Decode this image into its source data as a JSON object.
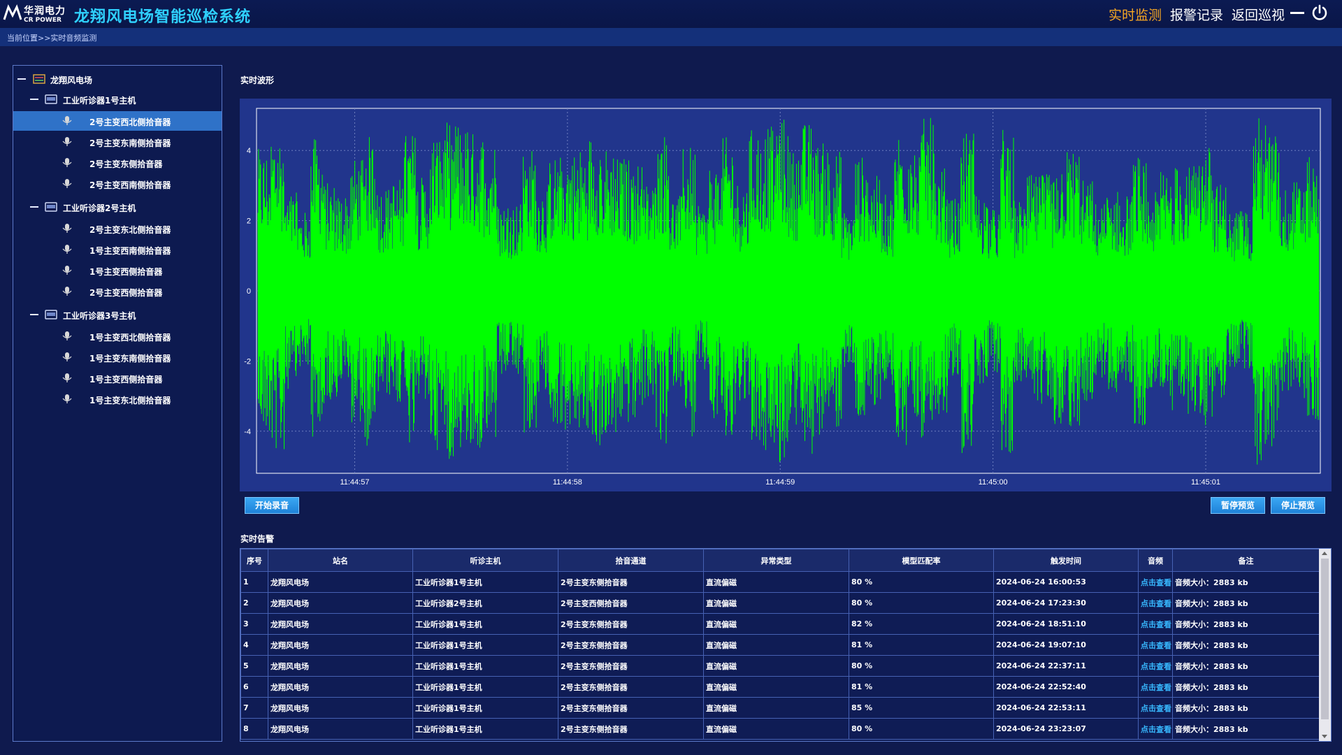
{
  "header": {
    "logo_main": "华润电力",
    "logo_sub": "CR POWER",
    "title": "龙翔风电场智能巡检系统",
    "nav": [
      {
        "label": "实时监测",
        "active": true
      },
      {
        "label": "报警记录",
        "active": false
      },
      {
        "label": "返回巡视",
        "active": false
      }
    ]
  },
  "breadcrumb": "当前位置>>实时音频监测",
  "tree": {
    "root": "龙翔风电场",
    "hosts": [
      {
        "name": "工业听诊器1号主机",
        "channels": [
          "2号主变西北侧拾音器",
          "2号主变东南侧拾音器",
          "2号主变东侧拾音器",
          "2号主变西南侧拾音器"
        ]
      },
      {
        "name": "工业听诊器2号主机",
        "channels": [
          "2号主变东北侧拾音器",
          "1号主变西南侧拾音器",
          "1号主变西侧拾音器",
          "2号主变西侧拾音器"
        ]
      },
      {
        "name": "工业听诊器3号主机",
        "channels": [
          "1号主变西北侧拾音器",
          "1号主变东南侧拾音器",
          "1号主变西侧拾音器",
          "1号主变东北侧拾音器"
        ]
      }
    ],
    "selected": "2号主变西北侧拾音器"
  },
  "waveform": {
    "section_title": "实时波形",
    "y_ticks": [
      "4",
      "2",
      "0",
      "-2",
      "-4"
    ],
    "x_ticks": [
      "11:44:57",
      "11:44:58",
      "11:44:59",
      "11:45:00",
      "11:45:01"
    ],
    "line_color": "#00ff00",
    "background_color": "#21358c",
    "buttons": {
      "record": "开始录音",
      "pause": "暂停预览",
      "stop": "停止预览"
    }
  },
  "alarms": {
    "section_title": "实时告警",
    "columns": [
      "序号",
      "站名",
      "听诊主机",
      "拾音通道",
      "异常类型",
      "模型匹配率",
      "触发时间",
      "音频",
      "备注"
    ],
    "rows": [
      [
        "1",
        "龙翔风电场",
        "工业听诊器1号主机",
        "2号主变东侧拾音器",
        "直流偏磁",
        "80 %",
        "2024-06-24 16:00:53",
        "点击查看",
        "音频大小：2883 kb"
      ],
      [
        "2",
        "龙翔风电场",
        "工业听诊器2号主机",
        "2号主变西侧拾音器",
        "直流偏磁",
        "80 %",
        "2024-06-24 17:23:30",
        "点击查看",
        "音频大小：2883 kb"
      ],
      [
        "3",
        "龙翔风电场",
        "工业听诊器1号主机",
        "2号主变东侧拾音器",
        "直流偏磁",
        "82 %",
        "2024-06-24 18:51:10",
        "点击查看",
        "音频大小：2883 kb"
      ],
      [
        "4",
        "龙翔风电场",
        "工业听诊器1号主机",
        "2号主变东侧拾音器",
        "直流偏磁",
        "81 %",
        "2024-06-24 19:07:10",
        "点击查看",
        "音频大小：2883 kb"
      ],
      [
        "5",
        "龙翔风电场",
        "工业听诊器1号主机",
        "2号主变东侧拾音器",
        "直流偏磁",
        "80 %",
        "2024-06-24 22:37:11",
        "点击查看",
        "音频大小：2883 kb"
      ],
      [
        "6",
        "龙翔风电场",
        "工业听诊器1号主机",
        "2号主变东侧拾音器",
        "直流偏磁",
        "81 %",
        "2024-06-24 22:52:40",
        "点击查看",
        "音频大小：2883 kb"
      ],
      [
        "7",
        "龙翔风电场",
        "工业听诊器1号主机",
        "2号主变东侧拾音器",
        "直流偏磁",
        "85 %",
        "2024-06-24 22:53:11",
        "点击查看",
        "音频大小：2883 kb"
      ],
      [
        "8",
        "龙翔风电场",
        "工业听诊器1号主机",
        "2号主变东侧拾音器",
        "直流偏磁",
        "80 %",
        "2024-06-24 23:23:07",
        "点击查看",
        "音频大小：2883 kb"
      ]
    ]
  }
}
